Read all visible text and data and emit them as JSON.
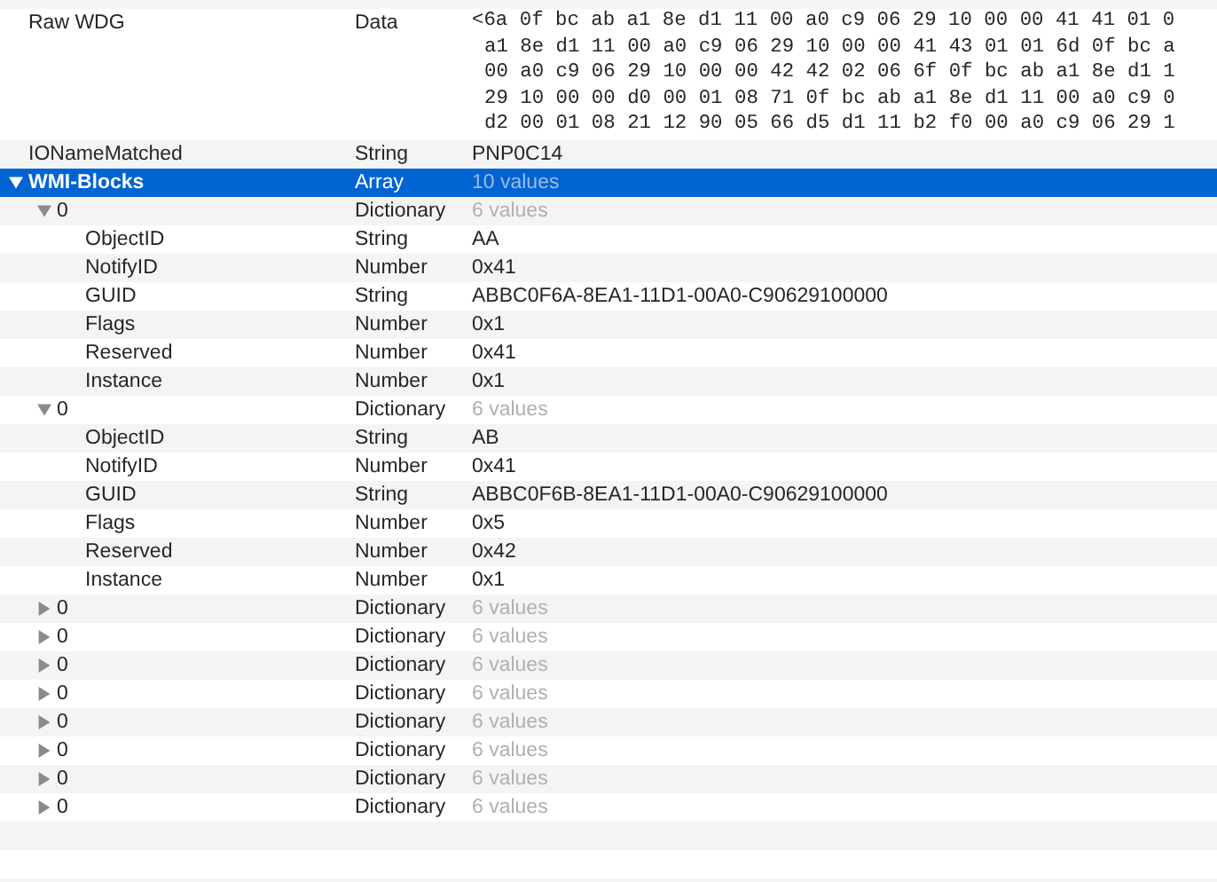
{
  "rows": [
    {
      "key": "Raw WDG",
      "type": "Data",
      "value_lines": [
        "<6a 0f bc ab a1 8e d1 11 00 a0 c9 06 29 10 00 00 41 41 01 0",
        "a1 8e d1 11 00 a0 c9 06 29 10 00 00 41 43 01 01 6d 0f bc a",
        "00 a0 c9 06 29 10 00 00 42 42 02 06 6f 0f bc ab a1 8e d1 1",
        "29 10 00 00 d0 00 01 08 71 0f bc ab a1 8e d1 11 00 a0 c9 0",
        "d2 00 01 08 21 12 90 05 66 d5 d1 11 b2 f0 00 a0 c9 06 29 1"
      ],
      "selected": false
    },
    {
      "key": "IONameMatched",
      "type": "String",
      "value": "PNP0C14",
      "selected": false
    },
    {
      "key": "WMI-Blocks",
      "type": "Array",
      "value": "10 values",
      "expanded": true,
      "selected": true,
      "children": [
        {
          "key": "0",
          "type": "Dictionary",
          "value": "6 values",
          "expanded": true,
          "selected": false,
          "children": [
            {
              "key": "ObjectID",
              "type": "String",
              "value": "AA",
              "selected": false
            },
            {
              "key": "NotifyID",
              "type": "Number",
              "value": "0x41",
              "selected": false
            },
            {
              "key": "GUID",
              "type": "String",
              "value": "ABBC0F6A-8EA1-11D1-00A0-C90629100000",
              "selected": false
            },
            {
              "key": "Flags",
              "type": "Number",
              "value": "0x1",
              "selected": false
            },
            {
              "key": "Reserved",
              "type": "Number",
              "value": "0x41",
              "selected": false
            },
            {
              "key": "Instance",
              "type": "Number",
              "value": "0x1",
              "selected": false
            }
          ]
        },
        {
          "key": "0",
          "type": "Dictionary",
          "value": "6 values",
          "expanded": true,
          "selected": false,
          "children": [
            {
              "key": "ObjectID",
              "type": "String",
              "value": "AB",
              "selected": false
            },
            {
              "key": "NotifyID",
              "type": "Number",
              "value": "0x41",
              "selected": false
            },
            {
              "key": "GUID",
              "type": "String",
              "value": "ABBC0F6B-8EA1-11D1-00A0-C90629100000",
              "selected": false
            },
            {
              "key": "Flags",
              "type": "Number",
              "value": "0x5",
              "selected": false
            },
            {
              "key": "Reserved",
              "type": "Number",
              "value": "0x42",
              "selected": false
            },
            {
              "key": "Instance",
              "type": "Number",
              "value": "0x1",
              "selected": false
            }
          ]
        },
        {
          "key": "0",
          "type": "Dictionary",
          "value": "6 values",
          "expanded": false,
          "selected": false
        },
        {
          "key": "0",
          "type": "Dictionary",
          "value": "6 values",
          "expanded": false,
          "selected": false
        },
        {
          "key": "0",
          "type": "Dictionary",
          "value": "6 values",
          "expanded": false,
          "selected": false
        },
        {
          "key": "0",
          "type": "Dictionary",
          "value": "6 values",
          "expanded": false,
          "selected": false
        },
        {
          "key": "0",
          "type": "Dictionary",
          "value": "6 values",
          "expanded": false,
          "selected": false
        },
        {
          "key": "0",
          "type": "Dictionary",
          "value": "6 values",
          "expanded": false,
          "selected": false
        },
        {
          "key": "0",
          "type": "Dictionary",
          "value": "6 values",
          "expanded": false,
          "selected": false
        },
        {
          "key": "0",
          "type": "Dictionary",
          "value": "6 values",
          "expanded": false,
          "selected": false
        }
      ]
    }
  ]
}
